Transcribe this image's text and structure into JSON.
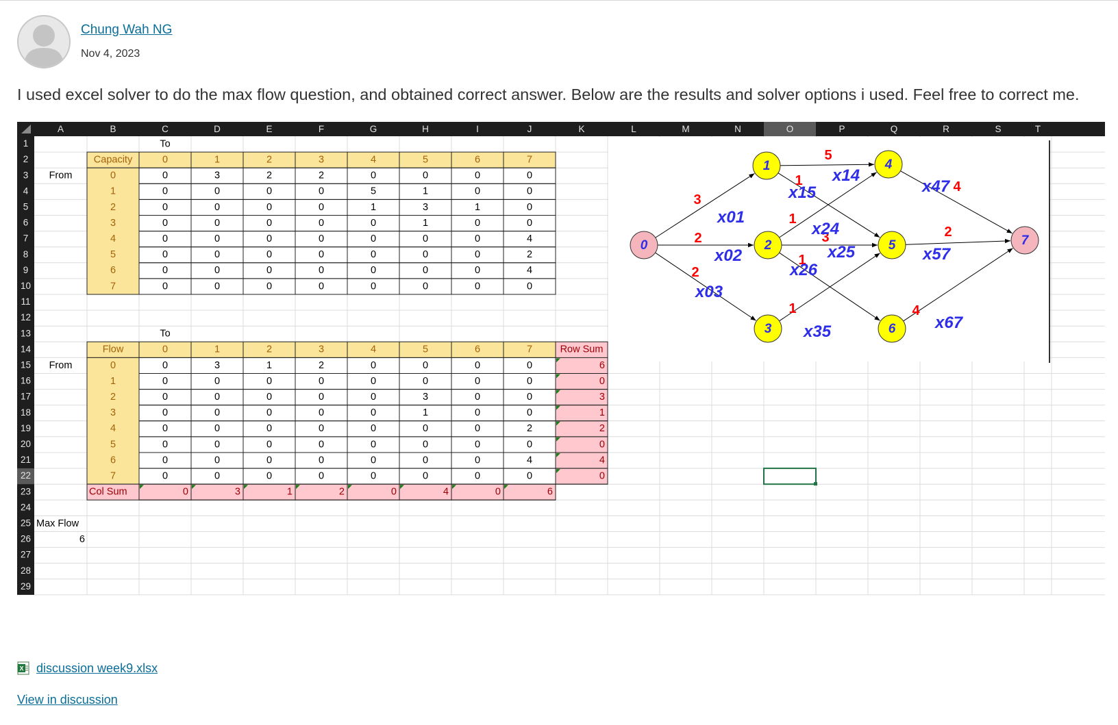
{
  "post": {
    "author": "Chung Wah NG",
    "date": "Nov 4, 2023",
    "message": "I used excel solver to do the max flow question, and obtained correct answer. Below are the results and solver options i used. Feel free to correct me."
  },
  "sheet": {
    "columns": [
      "A",
      "B",
      "C",
      "D",
      "E",
      "F",
      "G",
      "H",
      "I",
      "J",
      "K",
      "L",
      "M",
      "N",
      "O",
      "P",
      "Q",
      "R",
      "S",
      "T"
    ],
    "rows": [
      "1",
      "2",
      "3",
      "4",
      "5",
      "6",
      "7",
      "8",
      "9",
      "10",
      "11",
      "12",
      "13",
      "14",
      "15",
      "16",
      "17",
      "18",
      "19",
      "20",
      "21",
      "22",
      "23",
      "24",
      "25",
      "26",
      "27",
      "28",
      "29"
    ],
    "capacity": {
      "to_label": "To",
      "from_label": "From",
      "corner_label": "Capacity",
      "headers": [
        "0",
        "1",
        "2",
        "3",
        "4",
        "5",
        "6",
        "7"
      ],
      "matrix": [
        [
          "0",
          "3",
          "2",
          "2",
          "0",
          "0",
          "0",
          "0"
        ],
        [
          "0",
          "0",
          "0",
          "0",
          "5",
          "1",
          "0",
          "0"
        ],
        [
          "0",
          "0",
          "0",
          "0",
          "1",
          "3",
          "1",
          "0"
        ],
        [
          "0",
          "0",
          "0",
          "0",
          "0",
          "1",
          "0",
          "0"
        ],
        [
          "0",
          "0",
          "0",
          "0",
          "0",
          "0",
          "0",
          "4"
        ],
        [
          "0",
          "0",
          "0",
          "0",
          "0",
          "0",
          "0",
          "2"
        ],
        [
          "0",
          "0",
          "0",
          "0",
          "0",
          "0",
          "0",
          "4"
        ],
        [
          "0",
          "0",
          "0",
          "0",
          "0",
          "0",
          "0",
          "0"
        ]
      ]
    },
    "flow": {
      "to_label": "To",
      "from_label": "From",
      "corner_label": "Flow",
      "row_sum_label": "Row Sum",
      "col_sum_label": "Col Sum",
      "headers": [
        "0",
        "1",
        "2",
        "3",
        "4",
        "5",
        "6",
        "7"
      ],
      "matrix": [
        [
          "0",
          "3",
          "1",
          "2",
          "0",
          "0",
          "0",
          "0"
        ],
        [
          "0",
          "0",
          "0",
          "0",
          "0",
          "0",
          "0",
          "0"
        ],
        [
          "0",
          "0",
          "0",
          "0",
          "0",
          "3",
          "0",
          "0"
        ],
        [
          "0",
          "0",
          "0",
          "0",
          "0",
          "1",
          "0",
          "0"
        ],
        [
          "0",
          "0",
          "0",
          "0",
          "0",
          "0",
          "0",
          "2"
        ],
        [
          "0",
          "0",
          "0",
          "0",
          "0",
          "0",
          "0",
          "0"
        ],
        [
          "0",
          "0",
          "0",
          "0",
          "0",
          "0",
          "0",
          "4"
        ],
        [
          "0",
          "0",
          "0",
          "0",
          "0",
          "0",
          "0",
          "0"
        ]
      ],
      "row_sums": [
        "6",
        "0",
        "3",
        "1",
        "2",
        "0",
        "4",
        "0"
      ],
      "col_sums": [
        "0",
        "3",
        "1",
        "2",
        "0",
        "4",
        "0",
        "6"
      ]
    },
    "max_flow_label": "Max Flow",
    "max_flow_value": "6"
  },
  "diagram": {
    "nodes": [
      "0",
      "1",
      "2",
      "3",
      "4",
      "5",
      "6",
      "7"
    ],
    "capacity_labels": [
      "3",
      "2",
      "2",
      "5",
      "1",
      "1",
      "3",
      "1",
      "1",
      "4",
      "2",
      "4"
    ],
    "variable_labels": [
      "x01",
      "x02",
      "x03",
      "x14",
      "x15",
      "x24",
      "x25",
      "x26",
      "x35",
      "x47",
      "x57",
      "x67"
    ]
  },
  "attachment": {
    "name": "discussion week9.xlsx",
    "icon": "excel-file-icon"
  },
  "view_link": "View in discussion",
  "colors": {
    "link": "#0b6e98",
    "header_fill": "#fbe59a",
    "header_text": "#a3620a",
    "sum_fill": "#ffc7ce",
    "sum_text": "#9c0006",
    "node_yellow": "#ffff00",
    "node_pink": "#f4b5bc",
    "diagram_red": "#ff0000",
    "diagram_blue": "#2e2ee8",
    "sheet_header_bg": "#1e1e1e"
  }
}
